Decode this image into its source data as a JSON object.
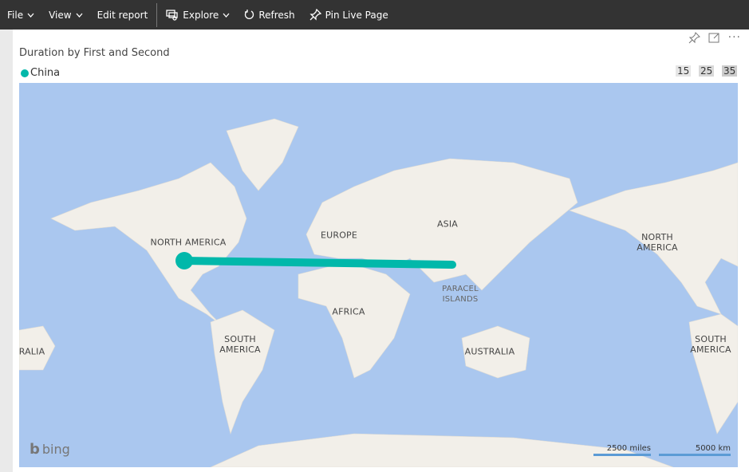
{
  "toolbar": {
    "file": "File",
    "view": "View",
    "edit_report": "Edit report",
    "explore": "Explore",
    "refresh": "Refresh",
    "pin_live_page": "Pin Live Page"
  },
  "visual": {
    "title": "Duration by First and Second",
    "legend": {
      "series": "China",
      "color": "#01b8aa"
    },
    "size_scale": [
      "15",
      "25",
      "35"
    ]
  },
  "map": {
    "labels": {
      "north_america": "NORTH AMERICA",
      "europe": "EUROPE",
      "asia": "ASIA",
      "africa": "AFRICA",
      "south_america": "SOUTH AMERICA",
      "australia": "AUSTRALIA",
      "paracel": "PARACEL ISLANDS",
      "north_america_2": "NORTH AMERICA",
      "south_america_2": "SOUTH AMERICA",
      "australia_partial": "RALIA"
    },
    "provider": "bing",
    "scale_miles": "2500 miles",
    "scale_km": "5000 km",
    "route": {
      "from": "North America",
      "to": "China",
      "color": "#01b8aa"
    }
  }
}
